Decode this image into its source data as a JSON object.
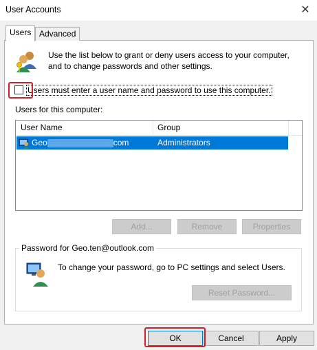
{
  "window": {
    "title": "User Accounts",
    "close_glyph": "✕"
  },
  "tabs": [
    {
      "label": "Users",
      "active": true
    },
    {
      "label": "Advanced",
      "active": false
    }
  ],
  "info": {
    "text": "Use the list below to grant or deny users access to your computer, and to change passwords and other settings.",
    "icon": "users-icon"
  },
  "checkbox": {
    "label": "Users must enter a user name and password to use this computer.",
    "checked": false
  },
  "users_list": {
    "label": "Users for this computer:",
    "columns": [
      "User Name",
      "Group"
    ],
    "rows": [
      {
        "user_prefix": "Geo",
        "user_suffix": "com",
        "group": "Administrators",
        "selected": true
      }
    ]
  },
  "list_buttons": {
    "add": "Add...",
    "remove": "Remove",
    "properties": "Properties"
  },
  "password_group": {
    "title": "Password for Geo.ten@outlook.com",
    "text": "To change your password, go to PC settings and select Users.",
    "reset_button": "Reset Password..."
  },
  "footer": {
    "ok": "OK",
    "cancel": "Cancel",
    "apply": "Apply"
  },
  "colors": {
    "accent": "#0078d7",
    "highlight_box": "#d0202a"
  }
}
